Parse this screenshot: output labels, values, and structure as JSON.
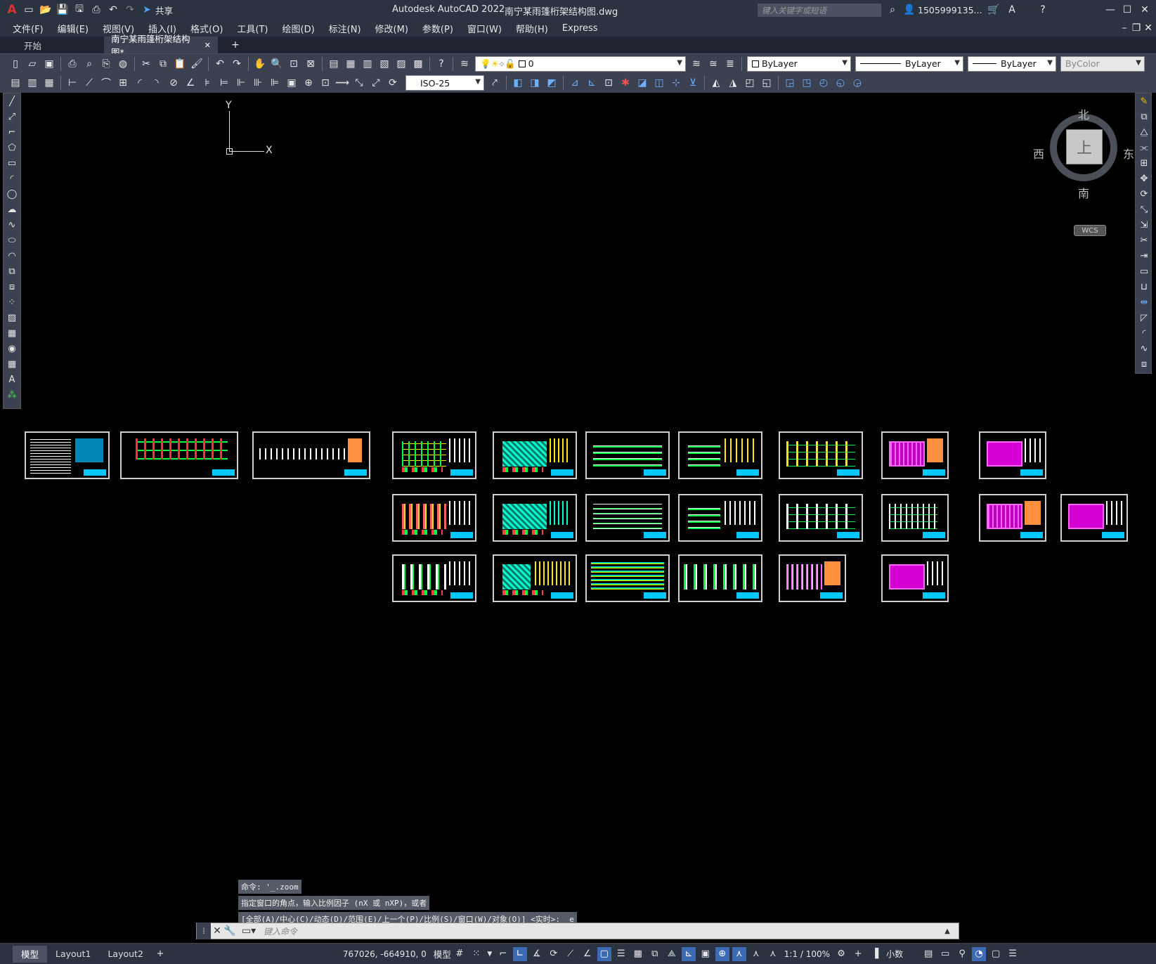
{
  "titlebar": {
    "app_title": "Autodesk AutoCAD 2022",
    "doc_title": "南宁某雨篷桁架结构图.dwg",
    "search_placeholder": "键入关键字或短语",
    "user": "1505999135...",
    "share": "共享"
  },
  "menus": [
    "文件(F)",
    "编辑(E)",
    "视图(V)",
    "插入(I)",
    "格式(O)",
    "工具(T)",
    "绘图(D)",
    "标注(N)",
    "修改(M)",
    "参数(P)",
    "窗口(W)",
    "帮助(H)",
    "Express"
  ],
  "tabs": {
    "start": "开始",
    "doc": "南宁某雨篷桁架结构图*",
    "add": "+"
  },
  "properties": {
    "layer": "0",
    "color": "ByLayer",
    "linetype": "ByLayer",
    "lineweight": "ByLayer",
    "plotstyle": "ByColor",
    "dimstyle": "ISO-25"
  },
  "ucs": {
    "x": "X",
    "y": "Y"
  },
  "viewcube": {
    "north": "北",
    "south": "南",
    "east": "东",
    "west": "西",
    "top": "上",
    "wcs": "WCS"
  },
  "command": {
    "history": [
      "命令: '_.zoom",
      "指定窗口的角点，输入比例因子 (nX 或 nXP)，或者",
      "[全部(A)/中心(C)/动态(D)/范围(E)/上一个(P)/比例(S)/窗口(W)/对象(O)] <实时>: _e"
    ],
    "placeholder": "键入命令"
  },
  "status": {
    "layouts": [
      "模型",
      "Layout1",
      "Layout2"
    ],
    "coords": "767026, -664910, 0",
    "model": "模型",
    "scale": "1:1 / 100%",
    "units": "小数"
  },
  "colors": {
    "accent": "#3d6bb3",
    "canvas": "#000000"
  }
}
